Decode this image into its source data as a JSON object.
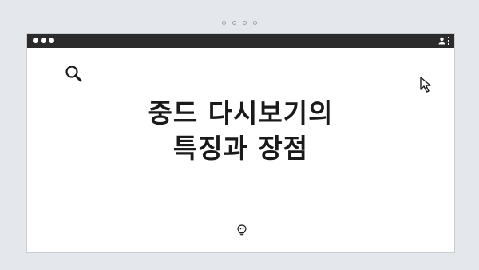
{
  "window": {
    "title_dots": 3,
    "menu_icons": [
      "user-icon",
      "kebab-menu-icon"
    ]
  },
  "content": {
    "headline_line1": "중드 다시보기의",
    "headline_line2": "특징과 장점"
  },
  "icons": {
    "left": "search-icon",
    "right": "cursor-icon",
    "bottom": "lightbulb-icon"
  },
  "colors": {
    "background": "#e4e7eb",
    "titlebar": "#2b2b2b",
    "card": "#ffffff",
    "text": "#1a1a1a"
  }
}
